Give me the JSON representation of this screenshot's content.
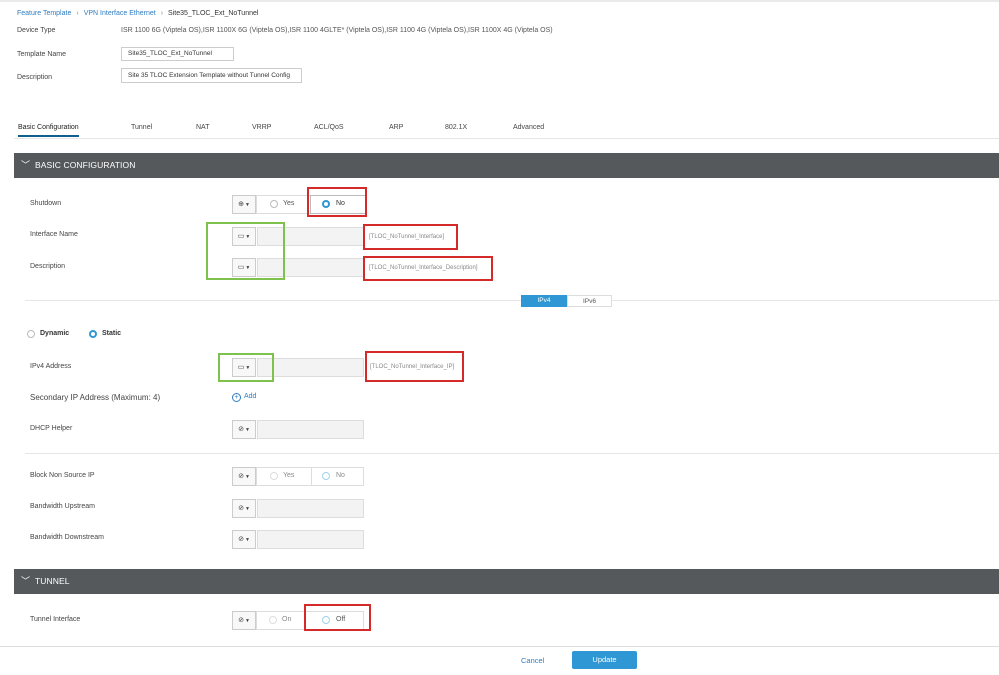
{
  "breadcrumb": {
    "item1": "Feature Template",
    "item2": "VPN Interface Ethernet",
    "current": "Site35_TLOC_Ext_NoTunnel"
  },
  "header": {
    "device_type_label": "Device Type",
    "device_type_value": "ISR 1100 6G (Viptela OS),ISR 1100X 6G (Viptela OS),ISR 1100 4GLTE* (Viptela OS),ISR 1100 4G (Viptela OS),ISR 1100X 4G (Viptela OS)",
    "template_name_label": "Template Name",
    "template_name_value": "Site35_TLOC_Ext_NoTunnel",
    "description_label": "Description",
    "description_value": "Site 35 TLOC Extension Template without Tunnel Config"
  },
  "tabs": [
    "Basic Configuration",
    "Tunnel",
    "NAT",
    "VRRP",
    "ACL/QoS",
    "ARP",
    "802.1X",
    "Advanced"
  ],
  "sections": {
    "basic": "BASIC CONFIGURATION",
    "tunnel": "TUNNEL"
  },
  "basic": {
    "shutdown_label": "Shutdown",
    "yes": "Yes",
    "no": "No",
    "interface_name_label": "Interface Name",
    "interface_name_var": "[TLOC_NoTunnel_Interface]",
    "description_label": "Description",
    "description_var": "[TLOC_NoTunnel_Interface_Description]",
    "ipv4_tab": "IPv4",
    "ipv6_tab": "IPv6",
    "dynamic": "Dynamic",
    "static": "Static",
    "ipv4_address_label": "IPv4 Address",
    "ipv4_address_var": "[TLOC_NoTunnel_Interface_IP]",
    "secondary_ip_label": "Secondary IP Address (Maximum: 4)",
    "add_label": "Add",
    "dhcp_helper_label": "DHCP Helper",
    "block_non_source_label": "Block Non Source IP",
    "block_yes": "Yes",
    "block_no": "No",
    "bw_up_label": "Bandwidth Upstream",
    "bw_down_label": "Bandwidth Downstream"
  },
  "tunnel": {
    "tunnel_interface_label": "Tunnel Interface",
    "on": "On",
    "off": "Off"
  },
  "footer": {
    "cancel": "Cancel",
    "update": "Update"
  },
  "colors": {
    "accent": "#2f97d4",
    "section_bar": "#55595c",
    "highlight_red": "#d42a2a",
    "highlight_green": "#7ec14d"
  }
}
